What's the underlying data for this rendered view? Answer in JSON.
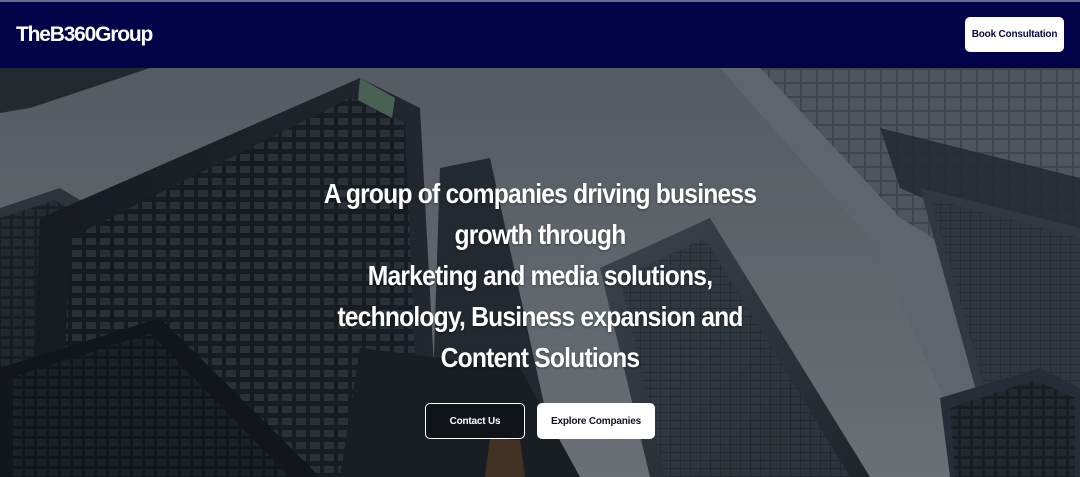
{
  "header": {
    "logo_text": "TheB360Group",
    "book_consultation_label": "Book Consultation",
    "background_color": "#03034a"
  },
  "hero": {
    "headline_lines": [
      "A group of companies driving business",
      "growth through",
      "Marketing and media solutions,",
      "technology, Business expansion and",
      "Content Solutions"
    ],
    "background_image": "city-skyscrapers-looking-up",
    "contact_label": "Contact Us",
    "explore_label": "Explore Companies"
  }
}
